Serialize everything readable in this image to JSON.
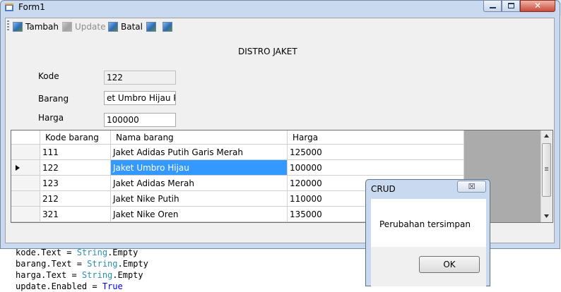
{
  "code_lines": [
    {
      "a": "kode.Text = ",
      "b": "String",
      "c": ".Empty"
    },
    {
      "a": "barang.Text = ",
      "b": "String",
      "c": ".Empty"
    },
    {
      "a": "harga.Text = ",
      "b": "String",
      "c": ".Empty"
    },
    {
      "a": "update.Enabled = ",
      "b": "",
      "c": "True"
    }
  ],
  "window": {
    "title": "Form1"
  },
  "toolbar": {
    "tambah": "Tambah",
    "update": "Update",
    "batal": "Batal"
  },
  "form": {
    "heading": "DISTRO JAKET",
    "kode_label": "Kode",
    "kode_value": "122",
    "barang_label": "Barang",
    "barang_value": "et Umbro Hijau Putih",
    "harga_label": "Harga",
    "harga_value": "100000"
  },
  "grid": {
    "headers": [
      "Kode barang",
      "Nama barang",
      "Harga"
    ],
    "rows": [
      {
        "kode": "111",
        "nama": "Jaket Adidas Putih Garis Merah",
        "harga": "125000"
      },
      {
        "kode": "122",
        "nama": "Jaket Umbro Hijau",
        "harga": "100000"
      },
      {
        "kode": "123",
        "nama": "Jaket Adidas Merah",
        "harga": "120000"
      },
      {
        "kode": "212",
        "nama": "Jaket Nike Putih",
        "harga": "110000"
      },
      {
        "kode": "321",
        "nama": "Jaket Nike Oren",
        "harga": "135000"
      }
    ]
  },
  "dialog": {
    "title": "CRUD",
    "message": "Perubahan tersimpan",
    "ok": "OK",
    "close": "☒"
  }
}
